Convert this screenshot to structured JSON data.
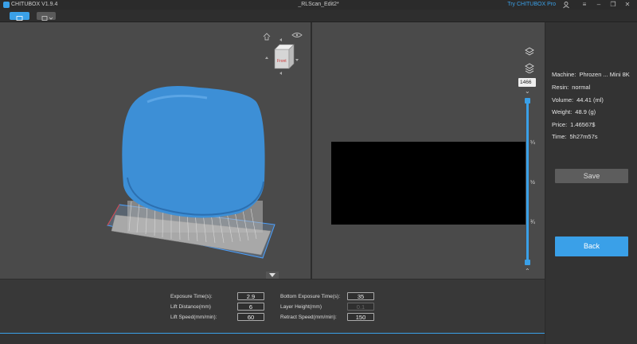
{
  "window": {
    "app_title": "CHITUBOX V1.9.4",
    "doc_title": "_RLScan_Edit2*",
    "try_pro": "Try CHITUBOX Pro"
  },
  "nav_cube": {
    "label": "Front"
  },
  "layer_slider": {
    "current_layer": "1466",
    "marks": [
      "¼",
      "½",
      "¾"
    ]
  },
  "info": {
    "machine_label": "Machine:",
    "machine_value": "Phrozen ... Mini 8K",
    "resin_label": "Resin:",
    "resin_value": "normal",
    "volume_label": "Volume:",
    "volume_value": "44.41  (ml)",
    "weight_label": "Weight:",
    "weight_value": "48.9  (g)",
    "price_label": "Price:",
    "price_value": "1.46567$",
    "time_label": "Time:",
    "time_value": "5h27m57s"
  },
  "buttons": {
    "save": "Save",
    "back": "Back"
  },
  "params": {
    "exposure_time_label": "Exposure Time(s):",
    "exposure_time_value": "2.9",
    "lift_distance_label": "Lift Distance(mm)",
    "lift_distance_value": "6",
    "lift_speed_label": "Lift Speed(mm/min):",
    "lift_speed_value": "60",
    "bottom_exposure_label": "Bottom Exposure Time(s):",
    "bottom_exposure_value": "35",
    "layer_height_label": "Layer Height(mm)",
    "layer_height_value": "0.1",
    "retract_speed_label": "Retract Speed(mm/min):",
    "retract_speed_value": "150"
  },
  "colors": {
    "accent": "#3aa0e8",
    "model": "#3d8fd6",
    "background": "#4a4a4a"
  }
}
